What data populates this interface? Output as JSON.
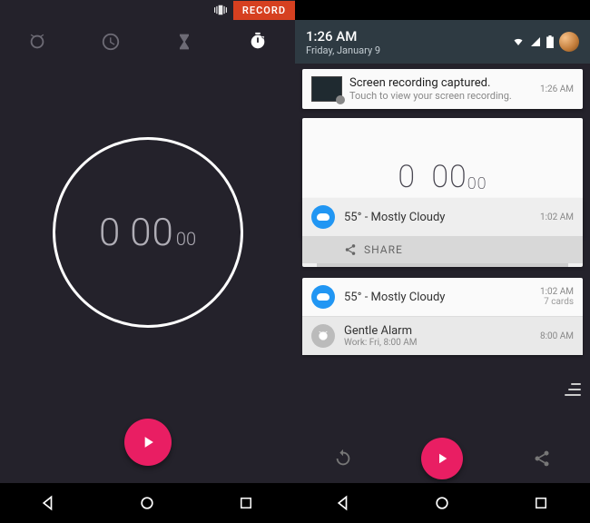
{
  "left": {
    "record_label": "RECORD",
    "stopwatch": {
      "minutes": "0",
      "seconds": "00",
      "centis": "00"
    }
  },
  "right": {
    "header": {
      "time": "1:26 AM",
      "date": "Friday, January 9"
    },
    "recording": {
      "title": "Screen recording captured.",
      "subtitle": "Touch to view your screen recording.",
      "timestamp": "1:26 AM"
    },
    "bg_stopwatch": {
      "minutes": "0",
      "seconds": "00",
      "centis": "00"
    },
    "weather1": {
      "title": "55° - Mostly Cloudy",
      "timestamp": "1:02 AM",
      "share_label": "SHARE"
    },
    "weather2": {
      "title": "55° - Mostly Cloudy",
      "timestamp": "1:02 AM",
      "sub": "7 cards"
    },
    "alarm": {
      "title": "Gentle Alarm",
      "subtitle": "Work: Fri, 8:00 AM",
      "timestamp": "8:00 AM"
    }
  }
}
